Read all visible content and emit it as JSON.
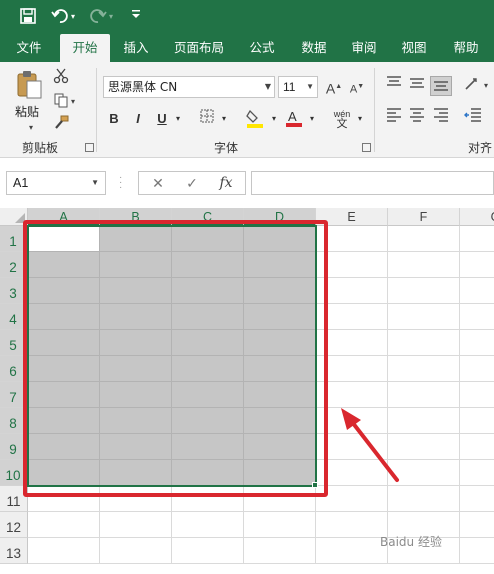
{
  "quick_access": {
    "save_icon": "save-icon",
    "undo_icon": "undo-icon",
    "redo_icon": "redo-icon",
    "customize_icon": "customize-icon"
  },
  "tabs": [
    {
      "label": "文件",
      "active": false
    },
    {
      "label": "开始",
      "active": true
    },
    {
      "label": "插入",
      "active": false
    },
    {
      "label": "页面布局",
      "active": false
    },
    {
      "label": "公式",
      "active": false
    },
    {
      "label": "数据",
      "active": false
    },
    {
      "label": "审阅",
      "active": false
    },
    {
      "label": "视图",
      "active": false
    },
    {
      "label": "帮助",
      "active": false
    }
  ],
  "ribbon": {
    "clipboard": {
      "paste_label": "粘贴",
      "group_label": "剪贴板"
    },
    "font": {
      "font_name": "思源黑体 CN",
      "font_size": "11",
      "bold": "B",
      "italic": "I",
      "underline": "U",
      "grow": "A",
      "shrink": "A",
      "phonetic": "wén",
      "phonetic_sub": "文",
      "group_label": "字体"
    },
    "alignment": {
      "group_label": "对齐"
    }
  },
  "formula_bar": {
    "name_box": "A1",
    "fx_label": "fx",
    "cancel": "✕",
    "enter": "✓",
    "formula": ""
  },
  "sheet": {
    "columns": [
      "A",
      "B",
      "C",
      "D",
      "E",
      "F",
      "G"
    ],
    "rows": [
      "1",
      "2",
      "3",
      "4",
      "5",
      "6",
      "7",
      "8",
      "9",
      "10",
      "11",
      "12",
      "13"
    ],
    "selected_range": "A1:D10",
    "active_cell": "A1"
  },
  "annotation": {
    "color": "#d9272e"
  },
  "watermark": "Baidu 经验"
}
